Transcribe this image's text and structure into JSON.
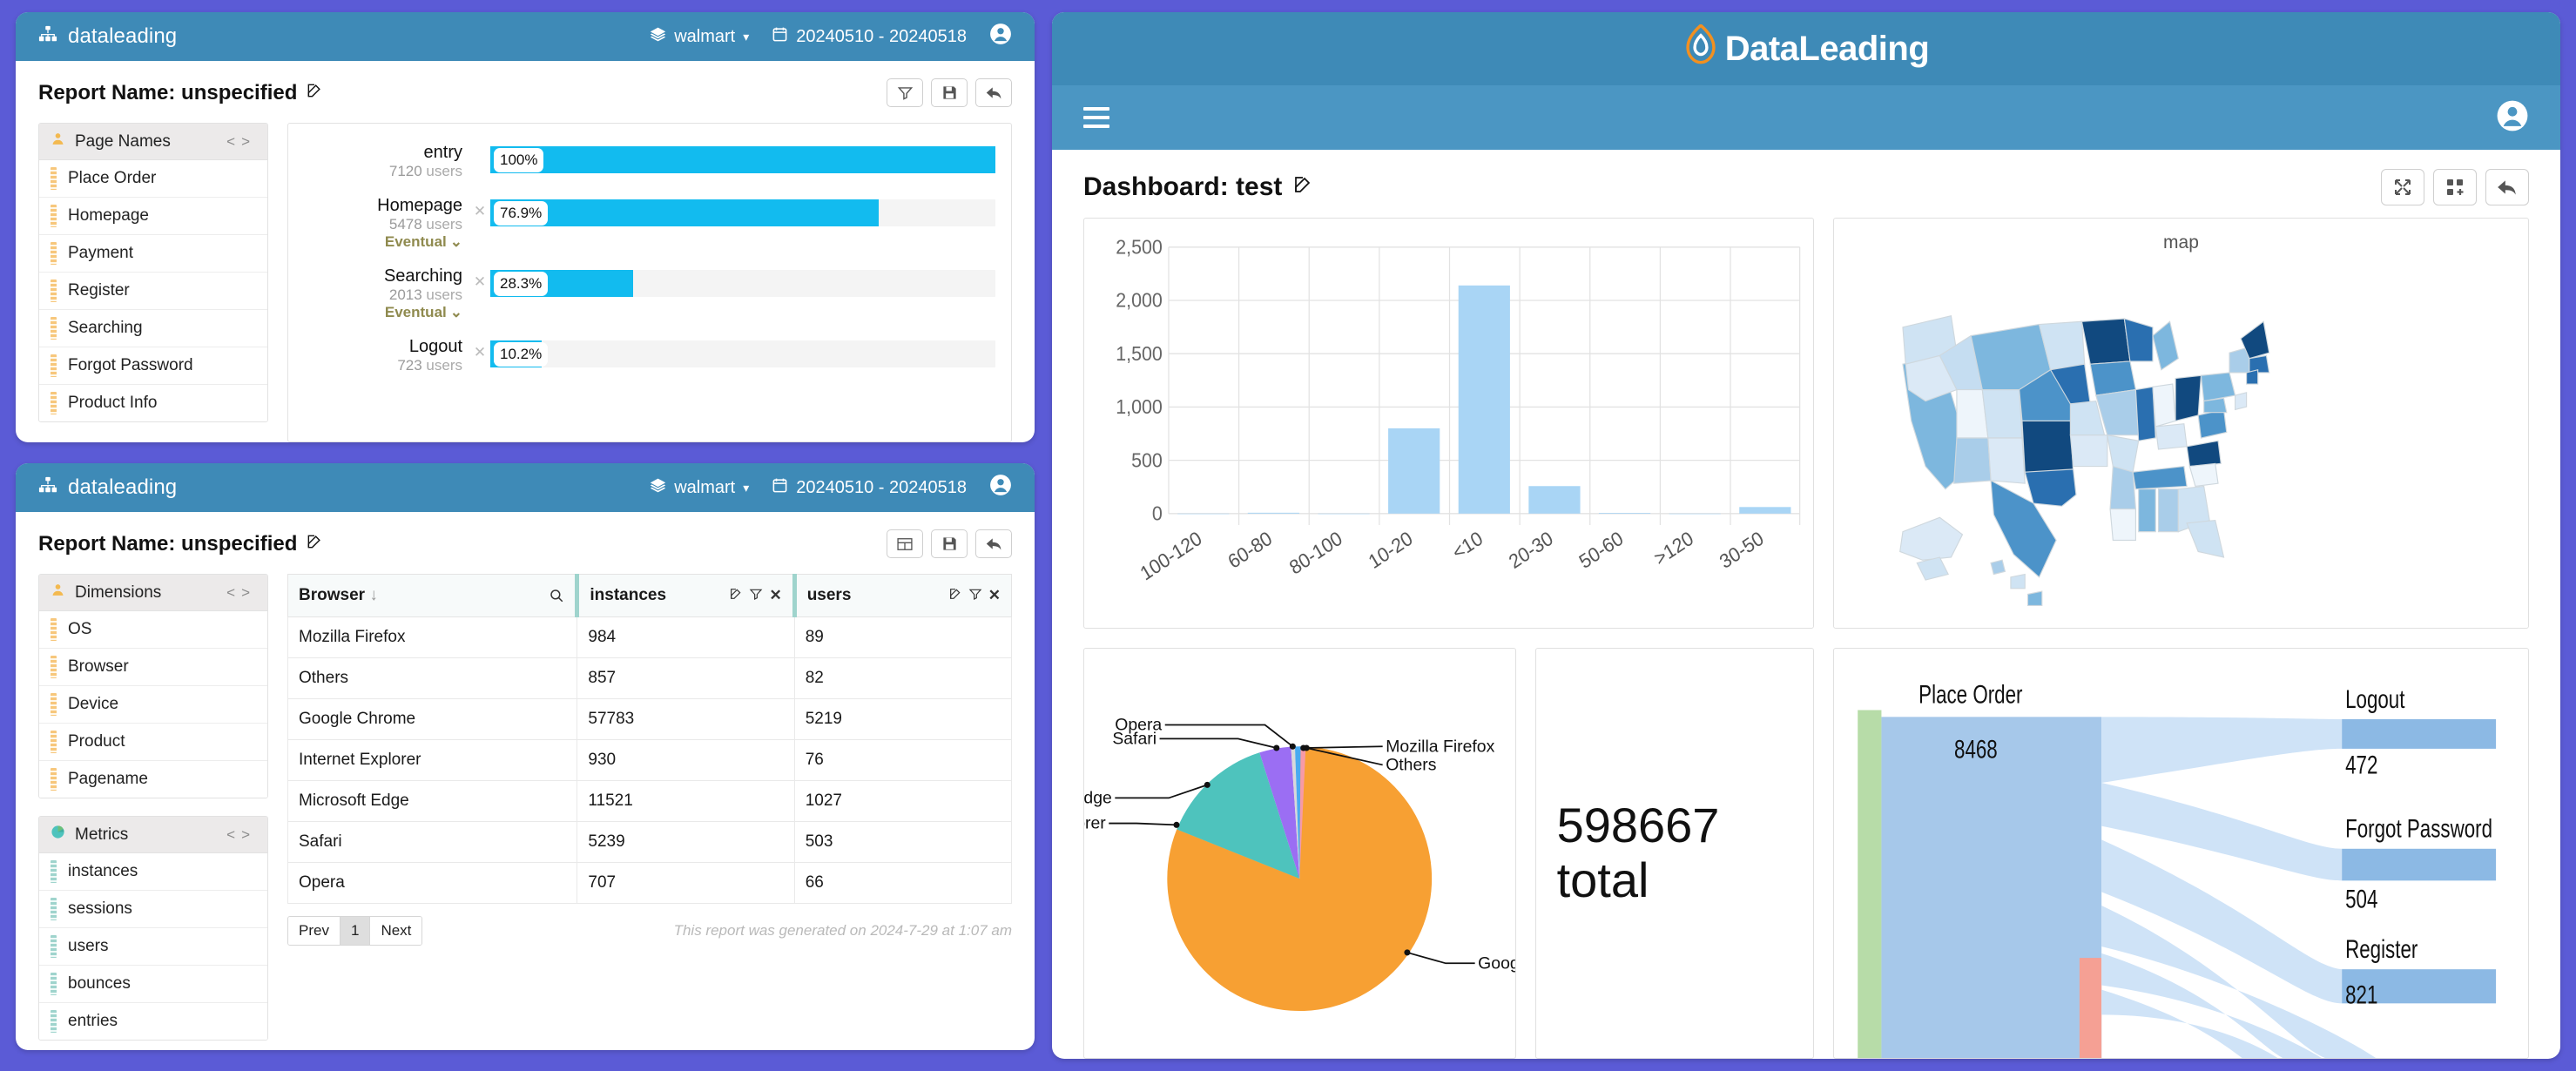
{
  "theme": {
    "desktop_bg": "#5b5bd6",
    "header_blue": "#3e8ab7",
    "bar_blue": "#4b96c3",
    "accent_cyan": "#12bbef",
    "accent_orange": "#f5a623"
  },
  "window_report": {
    "brand": "dataleading",
    "brand_icon": "sitemap-icon",
    "account": "walmart",
    "date_range": "20240510 - 20240518",
    "report_title": "Report Name: unspecified",
    "toolbar": [
      {
        "name": "filter-button",
        "icon": "filter-icon"
      },
      {
        "name": "save-button",
        "icon": "save-icon"
      },
      {
        "name": "back-button",
        "icon": "back-arrow-icon"
      }
    ],
    "sidebar": {
      "title": "Page Names",
      "icon": "person-icon",
      "prev": "<",
      "next": ">",
      "items": [
        "Place Order",
        "Homepage",
        "Payment",
        "Register",
        "Searching",
        "Forgot Password",
        "Product Info"
      ]
    },
    "funnel": {
      "eventual_label": "Eventual",
      "users_suffix": "users",
      "steps": [
        {
          "name": "entry",
          "users": "7120",
          "percent": "100%",
          "value": 100,
          "eventual": false,
          "has_x": false
        },
        {
          "name": "Homepage",
          "users": "5478",
          "percent": "76.9%",
          "value": 76.9,
          "eventual": true,
          "has_x": true
        },
        {
          "name": "Searching",
          "users": "2013",
          "percent": "28.3%",
          "value": 28.3,
          "eventual": true,
          "has_x": true
        },
        {
          "name": "Logout",
          "users": "723",
          "percent": "10.2%",
          "value": 10.2,
          "eventual": false,
          "has_x": true
        }
      ]
    }
  },
  "window_table": {
    "brand": "dataleading",
    "brand_icon": "sitemap-icon",
    "account": "walmart",
    "date_range": "20240510 - 20240518",
    "report_title": "Report Name: unspecified",
    "toolbar": [
      {
        "name": "table-view-button",
        "icon": "table-icon"
      },
      {
        "name": "save-button",
        "icon": "save-icon"
      },
      {
        "name": "back-button",
        "icon": "back-arrow-icon"
      }
    ],
    "dimensions": {
      "title": "Dimensions",
      "icon": "person-icon",
      "prev": "<",
      "next": ">",
      "items": [
        "OS",
        "Browser",
        "Device",
        "Product",
        "Pagename"
      ]
    },
    "metrics": {
      "title": "Metrics",
      "icon": "pie-icon",
      "prev": "<",
      "next": ">",
      "items": [
        "instances",
        "sessions",
        "users",
        "bounces",
        "entries"
      ]
    },
    "table": {
      "columns": [
        "Browser",
        "instances",
        "users"
      ],
      "sort_icon": "sort-down-icon",
      "search_icon": "search-icon",
      "col_icons": [
        "edit-icon",
        "filter-icon",
        "close-icon"
      ],
      "rows": [
        {
          "browser": "Mozilla Firefox",
          "instances": "984",
          "users": "89"
        },
        {
          "browser": "Others",
          "instances": "857",
          "users": "82"
        },
        {
          "browser": "Google Chrome",
          "instances": "57783",
          "users": "5219"
        },
        {
          "browser": "Internet Explorer",
          "instances": "930",
          "users": "76"
        },
        {
          "browser": "Microsoft Edge",
          "instances": "11521",
          "users": "1027"
        },
        {
          "browser": "Safari",
          "instances": "5239",
          "users": "503"
        },
        {
          "browser": "Opera",
          "instances": "707",
          "users": "66"
        }
      ]
    },
    "pagination": {
      "prev": "Prev",
      "page": "1",
      "next": "Next"
    },
    "generated_note": "This report was generated on 2024-7-29 at 1:07 am"
  },
  "dashboard": {
    "logo_text": "DataLeading",
    "logo_icon": "flame-icon",
    "menu_icon": "hamburger-icon",
    "account_icon": "user-circle-icon",
    "title": "Dashboard: test",
    "edit_icon": "edit-icon",
    "toolbar": [
      {
        "name": "expand-button",
        "icon": "expand-icon"
      },
      {
        "name": "add-widget-button",
        "icon": "add-widget-icon"
      },
      {
        "name": "back-button",
        "icon": "back-arrow-icon"
      }
    ],
    "map_title": "map",
    "total_value": "598667",
    "total_label": "total"
  },
  "chart_data": [
    {
      "type": "bar",
      "title": "",
      "categories": [
        "100-120",
        "60-80",
        "80-100",
        "10-20",
        "<10",
        "20-30",
        "50-60",
        ">120",
        "30-50"
      ],
      "values": [
        0,
        8,
        0,
        800,
        2140,
        258,
        6,
        0,
        62
      ],
      "ylim": [
        0,
        2500
      ],
      "yticks": [
        0,
        500,
        1000,
        1500,
        2000,
        2500
      ],
      "yticklabels": [
        "0",
        "500",
        "1,000",
        "1,500",
        "2,000",
        "2,500"
      ],
      "xlabel": "",
      "ylabel": "",
      "grid": true,
      "legend": false,
      "bar_color": "#a9d5f5"
    },
    {
      "type": "pie",
      "title": "",
      "labels": [
        "Google Chrome",
        "Microsoft Edge",
        "Safari",
        "Opera",
        "Mozilla Firefox",
        "Others",
        "Internet Explorer"
      ],
      "values": [
        57783,
        11521,
        5239,
        707,
        984,
        857,
        930
      ],
      "colors": [
        "#f7a033",
        "#4ec3bd",
        "#9b6ef3",
        "#d9d9d9",
        "#4aaaf0",
        "#f79aa6",
        "#fcc97a"
      ],
      "legend": "callout-labels"
    },
    {
      "type": "heatmap",
      "title": "map",
      "subtype": "us-choropleth",
      "colorscale": [
        "#eef5fb",
        "#cfe3f3",
        "#a9cde9",
        "#7db7de",
        "#4c93c9",
        "#2a6fb0",
        "#11497f"
      ]
    },
    {
      "type": "sankey",
      "title": "",
      "nodes": [
        {
          "name": "Place Order",
          "value": "8468",
          "side": "left"
        },
        {
          "name": "Logout",
          "value": "472",
          "side": "right"
        },
        {
          "name": "Forgot Password",
          "value": "504",
          "side": "right"
        },
        {
          "name": "Register",
          "value": "821",
          "side": "right"
        }
      ],
      "link_color": "#cfe3f7",
      "node_colors": {
        "source": "#a6c8ea",
        "entry": "#b7dca8",
        "exit": "#f5a094"
      }
    }
  ]
}
